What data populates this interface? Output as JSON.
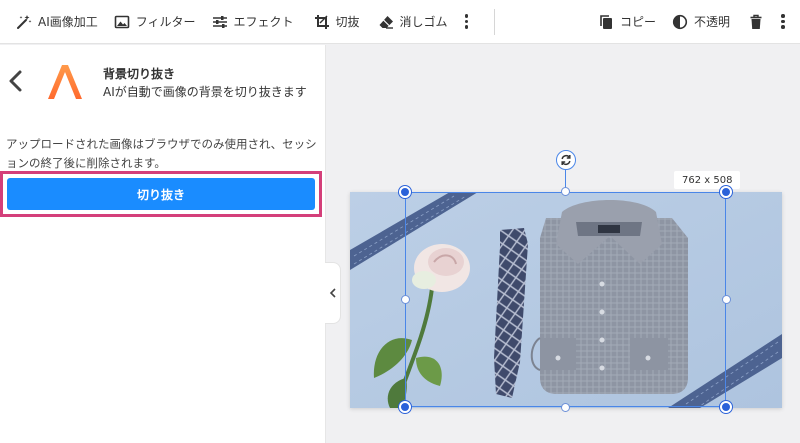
{
  "toolbar": {
    "items": [
      {
        "label": "AI画像加工",
        "icon": "magic-wand-icon"
      },
      {
        "label": "フィルター",
        "icon": "image-icon"
      },
      {
        "label": "エフェクト",
        "icon": "sliders-icon"
      },
      {
        "label": "切抜",
        "icon": "crop-icon"
      },
      {
        "label": "消しゴム",
        "icon": "eraser-icon"
      }
    ],
    "right_items": [
      {
        "label": "コピー",
        "icon": "copy-icon"
      },
      {
        "label": "不透明",
        "icon": "opacity-icon"
      }
    ]
  },
  "panel": {
    "title": "背景切り抜き",
    "subtitle": "AIが自動で画像の背景を切り抜きます",
    "description": "アップロードされた画像はブラウザでのみ使用され、セッションの終了後に削除されます。",
    "cut_button": "切り抜き"
  },
  "canvas": {
    "size_label": "762 x 508"
  },
  "colors": {
    "accent": "#1a8cff",
    "highlight": "#d43f7a",
    "selection": "#2b62d9",
    "photo_background": "#b8cde6"
  }
}
